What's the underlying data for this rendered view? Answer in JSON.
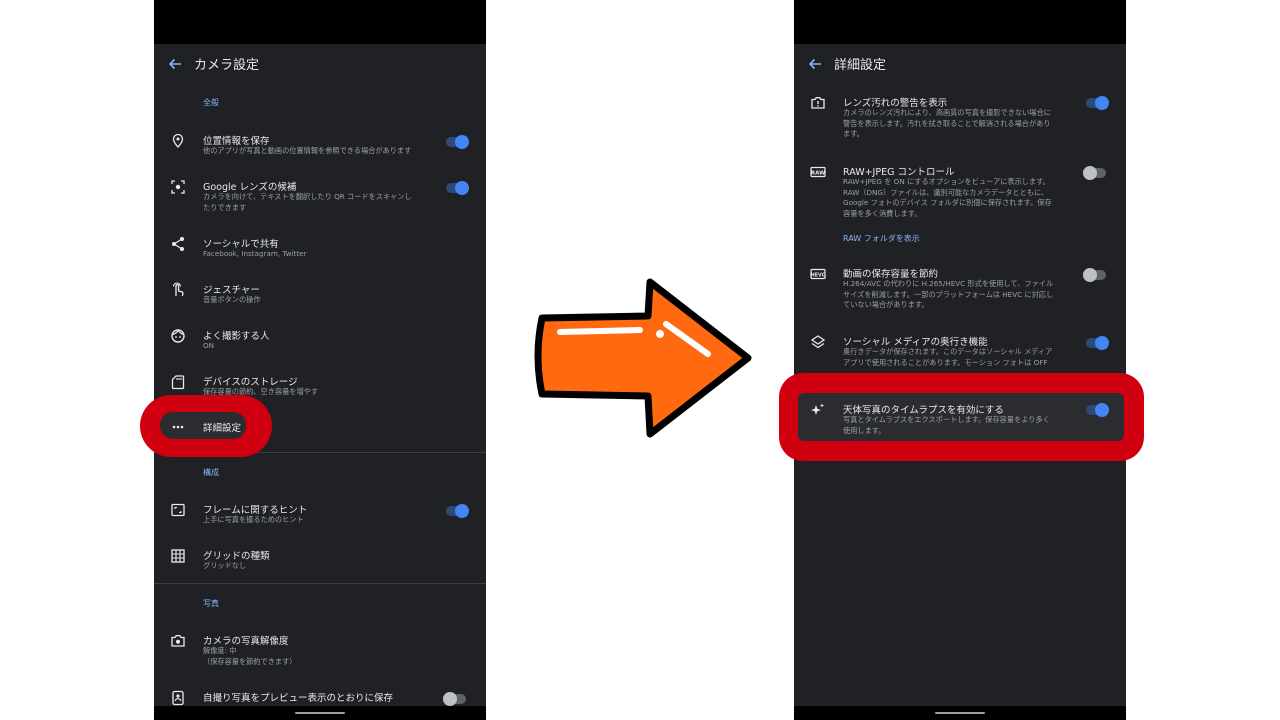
{
  "left": {
    "header_title": "カメラ設定",
    "sections": {
      "general": "全般",
      "composition": "構成",
      "photo": "写真"
    },
    "items": [
      {
        "title": "位置情報を保存",
        "sub": "他のアプリが写真と動画の位置情報を参照できる場合があります",
        "toggle": "on",
        "icon": "location-pin-icon"
      },
      {
        "title": "Google レンズの候補",
        "sub": "カメラを向けて、テキストを翻訳したり QR コードをスキャンし\nたりできます",
        "toggle": "on",
        "icon": "lens-icon"
      },
      {
        "title": "ソーシャルで共有",
        "sub": "Facebook, Instagram, Twitter",
        "icon": "share-icon"
      },
      {
        "title": "ジェスチャー",
        "sub": "音量ボタンの操作",
        "icon": "gesture-hand-icon"
      },
      {
        "title": "よく撮影する人",
        "sub": "ON",
        "icon": "face-icon"
      },
      {
        "title": "デバイスのストレージ",
        "sub": "保存容量の節約、空き容量を増やす",
        "icon": "sd-card-icon"
      },
      {
        "title": "詳細設定",
        "icon": "more-dots-icon"
      },
      {
        "title": "フレームに関するヒント",
        "sub": "上手に写真を撮るためのヒント",
        "toggle": "on",
        "icon": "frame-icon"
      },
      {
        "title": "グリッドの種類",
        "sub": "グリッドなし",
        "icon": "grid-icon"
      },
      {
        "title": "カメラの写真解像度",
        "sub": "解像度: 中\n（保存容量を節約できます）",
        "icon": "camera-icon"
      },
      {
        "title": "自撮り写真をプレビュー表示のとおりに保存",
        "toggle": "off",
        "icon": "selfie-icon"
      }
    ]
  },
  "right": {
    "header_title": "詳細設定",
    "items": [
      {
        "title": "レンズ汚れの警告を表示",
        "sub": "カメラのレンズ汚れにより、高画質の写真を撮影できない場合に\n警告を表示します。汚れを拭き取ることで解消される場合があり\nます。",
        "toggle": "on",
        "icon": "lens-warning-icon"
      },
      {
        "title": "RAW+JPEG コントロール",
        "sub": "RAW+JPEG を ON にするオプションをビューアに表示します。\nRAW（DNG）ファイルは、識別可能なカメラデータとともに、\nGoogle フォトのデバイス フォルダに別個に保存されます。保存\n容量を多く消費します。",
        "toggle": "off",
        "icon": "raw-icon",
        "link": "RAW フォルダを表示"
      },
      {
        "title": "動画の保存容量を節約",
        "sub": "H.264/AVC の代わりに H.265/HEVC 形式を使用して、ファイル\nサイズを削減します。一部のプラットフォームは HEVC に対応し\nていない場合があります。",
        "toggle": "off",
        "icon": "hevc-icon"
      },
      {
        "title": "ソーシャル メディアの奥行き機能",
        "sub": "奥行きデータが保存されます。このデータはソーシャル メディア\nアプリで使用されることがあります。モーション フォトは OFF",
        "toggle": "on",
        "icon": "layers-icon"
      },
      {
        "title": "天体写真のタイムラプスを有効にする",
        "sub": "写真とタイムラプスをエクスポートします。保存容量をより多く\n使用します。",
        "toggle": "on",
        "icon": "sparkle-icon"
      }
    ]
  },
  "icons": {
    "arrow": "right-arrow-icon",
    "back": "back-arrow-icon"
  },
  "colors": {
    "accent": "#8ab4f8",
    "toggle_on": "#4285f4",
    "highlight": "#d00010",
    "arrow": "#ff6a10",
    "background": "#202124"
  }
}
